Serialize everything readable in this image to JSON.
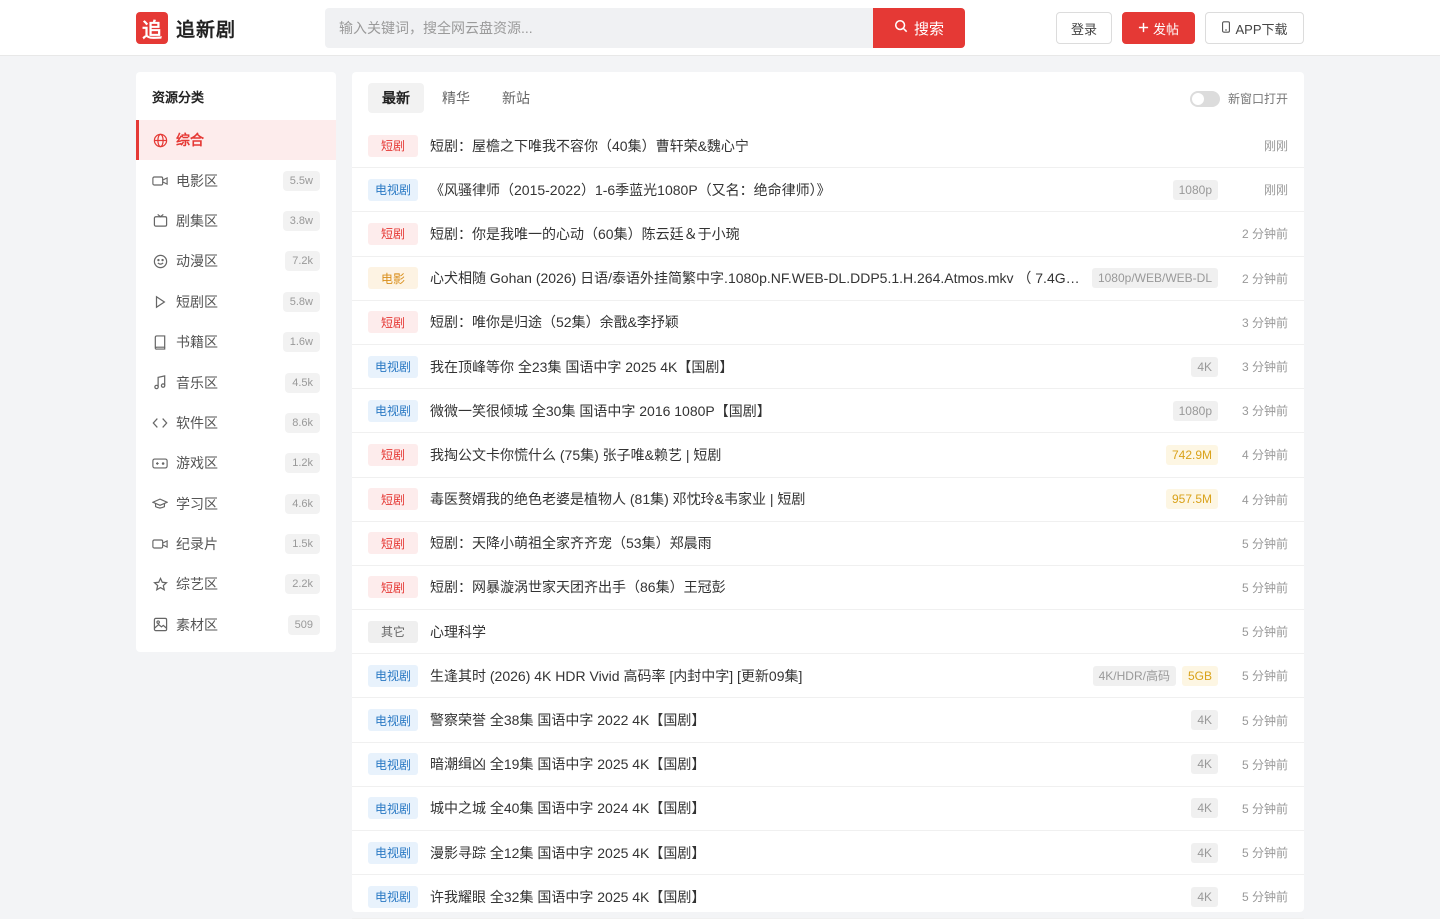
{
  "header": {
    "logo_mark": "追",
    "logo_text": "追新剧",
    "search_placeholder": "输入关键词，搜全网云盘资源...",
    "search_button": "搜索",
    "login": "登录",
    "post": "发帖",
    "app_download": "APP下载"
  },
  "sidebar": {
    "title": "资源分类",
    "items": [
      {
        "label": "综合",
        "count": "",
        "icon": "globe-icon",
        "active": true
      },
      {
        "label": "电影区",
        "count": "5.5w",
        "icon": "video-camera-icon"
      },
      {
        "label": "剧集区",
        "count": "3.8w",
        "icon": "tv-icon"
      },
      {
        "label": "动漫区",
        "count": "7.2k",
        "icon": "smile-icon"
      },
      {
        "label": "短剧区",
        "count": "5.8w",
        "icon": "play-icon"
      },
      {
        "label": "书籍区",
        "count": "1.6w",
        "icon": "book-icon"
      },
      {
        "label": "音乐区",
        "count": "4.5k",
        "icon": "music-icon"
      },
      {
        "label": "软件区",
        "count": "8.6k",
        "icon": "code-icon"
      },
      {
        "label": "游戏区",
        "count": "1.2k",
        "icon": "gamepad-icon"
      },
      {
        "label": "学习区",
        "count": "4.6k",
        "icon": "graduation-cap-icon"
      },
      {
        "label": "纪录片",
        "count": "1.5k",
        "icon": "video-camera-icon"
      },
      {
        "label": "综艺区",
        "count": "2.2k",
        "icon": "star-icon"
      },
      {
        "label": "素材区",
        "count": "509",
        "icon": "image-icon"
      }
    ]
  },
  "main": {
    "tabs": [
      {
        "label": "最新",
        "active": true
      },
      {
        "label": "精华",
        "active": false
      },
      {
        "label": "新站",
        "active": false
      }
    ],
    "toggle_label": "新窗口打开",
    "rows": [
      {
        "tag": "短剧",
        "type": "short",
        "title": "短剧：屋檐之下唯我不容你（40集）曹轩荣&魏心宁",
        "badges": [],
        "time": "刚刚"
      },
      {
        "tag": "电视剧",
        "type": "tv",
        "title": "《风骚律师（2015-2022）1-6季蓝光1080P（又名：绝命律师）》",
        "badges": [
          {
            "text": "1080p",
            "kind": "q"
          }
        ],
        "time": "刚刚"
      },
      {
        "tag": "短剧",
        "type": "short",
        "title": "短剧：你是我唯一的心动（60集）陈云廷＆于小琬",
        "badges": [],
        "time": "2 分钟前"
      },
      {
        "tag": "电影",
        "type": "movie",
        "title": "心犬相随 Gohan (2026) 日语/泰语外挂简繁中字.1080p.NF.WEB-DL.DDP5.1.H.264.Atmos.mkv （ 7.4G ）",
        "badges": [
          {
            "text": "1080p/WEB/WEB-DL",
            "kind": "q"
          }
        ],
        "time": "2 分钟前"
      },
      {
        "tag": "短剧",
        "type": "short",
        "title": "短剧：唯你是归途（52集）余戬&李抒颖",
        "badges": [],
        "time": "3 分钟前"
      },
      {
        "tag": "电视剧",
        "type": "tv",
        "title": "我在顶峰等你 全23集 国语中字 2025 4K【国剧】",
        "badges": [
          {
            "text": "4K",
            "kind": "q"
          }
        ],
        "time": "3 分钟前"
      },
      {
        "tag": "电视剧",
        "type": "tv",
        "title": "微微一笑很倾城 全30集 国语中字 2016 1080P【国剧】",
        "badges": [
          {
            "text": "1080p",
            "kind": "q"
          }
        ],
        "time": "3 分钟前"
      },
      {
        "tag": "短剧",
        "type": "short",
        "title": "我掏公文卡你慌什么 (75集) 张子唯&赖艺 | 短剧",
        "badges": [
          {
            "text": "742.9M",
            "kind": "size"
          }
        ],
        "time": "4 分钟前"
      },
      {
        "tag": "短剧",
        "type": "short",
        "title": "毒医赘婿我的绝色老婆是植物人 (81集) 邓忱玲&韦家业 | 短剧",
        "badges": [
          {
            "text": "957.5M",
            "kind": "size"
          }
        ],
        "time": "4 分钟前"
      },
      {
        "tag": "短剧",
        "type": "short",
        "title": "短剧：天降小萌祖全家齐齐宠（53集）郑晨雨",
        "badges": [],
        "time": "5 分钟前"
      },
      {
        "tag": "短剧",
        "type": "short",
        "title": "短剧：网暴漩涡世家天团齐出手（86集）王冠彭",
        "badges": [],
        "time": "5 分钟前"
      },
      {
        "tag": "其它",
        "type": "other",
        "title": "心理科学",
        "badges": [],
        "time": "5 分钟前"
      },
      {
        "tag": "电视剧",
        "type": "tv",
        "title": "生逢其时 (2026) 4K HDR Vivid 高码率 [内封中字] [更新09集]",
        "badges": [
          {
            "text": "4K/HDR/高码",
            "kind": "q"
          },
          {
            "text": "5GB",
            "kind": "size"
          }
        ],
        "time": "5 分钟前"
      },
      {
        "tag": "电视剧",
        "type": "tv",
        "title": "警察荣誉 全38集 国语中字 2022 4K【国剧】",
        "badges": [
          {
            "text": "4K",
            "kind": "q"
          }
        ],
        "time": "5 分钟前"
      },
      {
        "tag": "电视剧",
        "type": "tv",
        "title": "暗潮缉凶 全19集 国语中字 2025 4K【国剧】",
        "badges": [
          {
            "text": "4K",
            "kind": "q"
          }
        ],
        "time": "5 分钟前"
      },
      {
        "tag": "电视剧",
        "type": "tv",
        "title": "城中之城 全40集 国语中字 2024 4K【国剧】",
        "badges": [
          {
            "text": "4K",
            "kind": "q"
          }
        ],
        "time": "5 分钟前"
      },
      {
        "tag": "电视剧",
        "type": "tv",
        "title": "漫影寻踪 全12集 国语中字 2025 4K【国剧】",
        "badges": [
          {
            "text": "4K",
            "kind": "q"
          }
        ],
        "time": "5 分钟前"
      },
      {
        "tag": "电视剧",
        "type": "tv",
        "title": "许我耀眼 全32集 国语中字 2025 4K【国剧】",
        "badges": [
          {
            "text": "4K",
            "kind": "q"
          }
        ],
        "time": "5 分钟前"
      }
    ]
  },
  "colors": {
    "accent": "#e53935",
    "tv_tag": "#2a79c4",
    "movie_tag": "#d98e1a"
  }
}
